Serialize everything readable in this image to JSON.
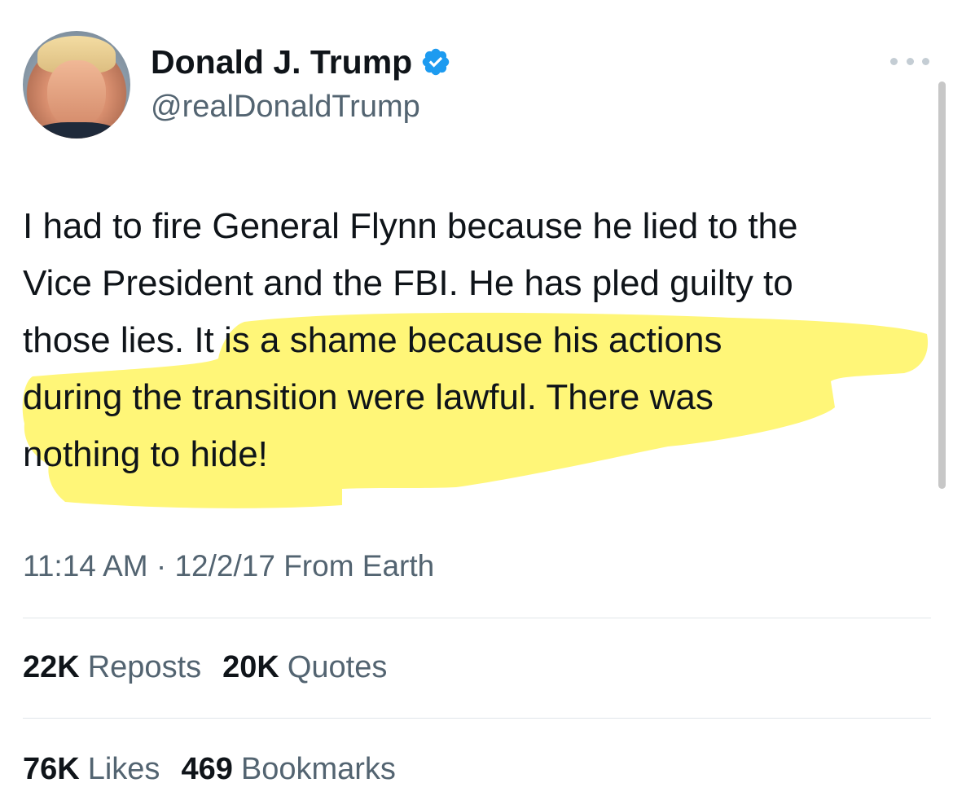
{
  "author": {
    "display_name": "Donald J. Trump",
    "handle": "@realDonaldTrump",
    "verified_icon": "verified-badge-icon",
    "verified_color": "#1d9bf0"
  },
  "tweet": {
    "text": "I had to fire General Flynn because he lied to the\nVice President and the FBI. He has pled guilty to\nthose lies. It is a shame because his actions\nduring the transition were lawful. There was\nnothing to hide!",
    "timestamp": "11:14 AM · 12/2/17 From Earth",
    "highlight_color": "#fff45a"
  },
  "stats": {
    "reposts_count": "22K",
    "reposts_label": "Reposts",
    "quotes_count": "20K",
    "quotes_label": "Quotes",
    "likes_count": "76K",
    "likes_label": "Likes",
    "bookmarks_count": "469",
    "bookmarks_label": "Bookmarks"
  },
  "colors": {
    "text_primary": "#0f1419",
    "text_secondary": "#536471",
    "divider": "#e1e6ea"
  }
}
